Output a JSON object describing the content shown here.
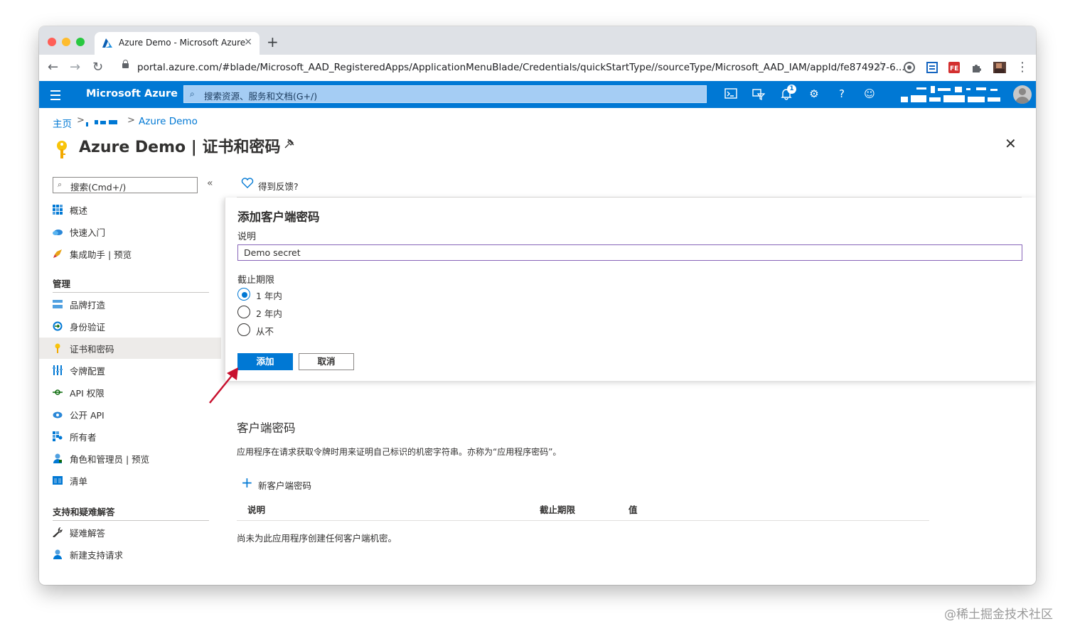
{
  "browser": {
    "tab_title": "Azure Demo - Microsoft Azure",
    "tab_close": "×",
    "new_tab": "+",
    "url": "portal.azure.com/#blade/Microsoft_AAD_RegisteredApps/ApplicationMenuBlade/Credentials/quickStartType//sourceType/Microsoft_AAD_IAM/appId/fe874927-6...",
    "back": "←",
    "forward": "→",
    "reload": "↻",
    "star": "☆",
    "menu": "⋮"
  },
  "azure": {
    "brand": "Microsoft Azure",
    "search_placeholder": "搜索资源、服务和文档(G+/)",
    "notifications_count": "1",
    "colors": {
      "header": "#0078d4",
      "accent": "#0078d4"
    }
  },
  "breadcrumb": {
    "home": "主页",
    "sep": ">",
    "current": "Azure Demo"
  },
  "page": {
    "title": "Azure Demo | 证书和密码",
    "close": "✕"
  },
  "sidebar": {
    "search_placeholder": "搜索(Cmd+/)",
    "collapse": "«",
    "items_top": [
      {
        "label": "概述",
        "icon": "grid-icon"
      },
      {
        "label": "快速入门",
        "icon": "cloud-icon"
      },
      {
        "label": "集成助手 | 预览",
        "icon": "rocket-icon"
      }
    ],
    "section_manage": "管理",
    "items_manage": [
      {
        "label": "品牌打造",
        "icon": "branding-icon"
      },
      {
        "label": "身份验证",
        "icon": "authentication-icon"
      },
      {
        "label": "证书和密码",
        "icon": "key-icon",
        "active": true
      },
      {
        "label": "令牌配置",
        "icon": "token-icon"
      },
      {
        "label": "API 权限",
        "icon": "api-permissions-icon"
      },
      {
        "label": "公开 API",
        "icon": "cloud-api-icon"
      },
      {
        "label": "所有者",
        "icon": "owners-icon"
      },
      {
        "label": "角色和管理员 | 预览",
        "icon": "roles-icon"
      },
      {
        "label": "清单",
        "icon": "manifest-icon"
      }
    ],
    "section_support": "支持和疑难解答",
    "items_support": [
      {
        "label": "疑难解答",
        "icon": "wrench-icon"
      },
      {
        "label": "新建支持请求",
        "icon": "support-person-icon"
      }
    ]
  },
  "feedback": {
    "label": "得到反馈?"
  },
  "add_secret_panel": {
    "title": "添加客户端密码",
    "description_label": "说明",
    "description_value": "Demo secret",
    "expires_label": "截止期限",
    "options": [
      {
        "label": "1 年内",
        "selected": true
      },
      {
        "label": "2 年内",
        "selected": false
      },
      {
        "label": "从不",
        "selected": false
      }
    ],
    "add_button": "添加",
    "cancel_button": "取消"
  },
  "client_secrets": {
    "title": "客户端密码",
    "description": "应用程序在请求获取令牌时用来证明自己标识的机密字符串。亦称为“应用程序密码”。",
    "new_button": "新客户端密码",
    "columns": [
      "说明",
      "截止期限",
      "值"
    ],
    "empty": "尚未为此应用程序创建任何客户端机密。"
  },
  "watermark": "@稀土掘金技术社区"
}
